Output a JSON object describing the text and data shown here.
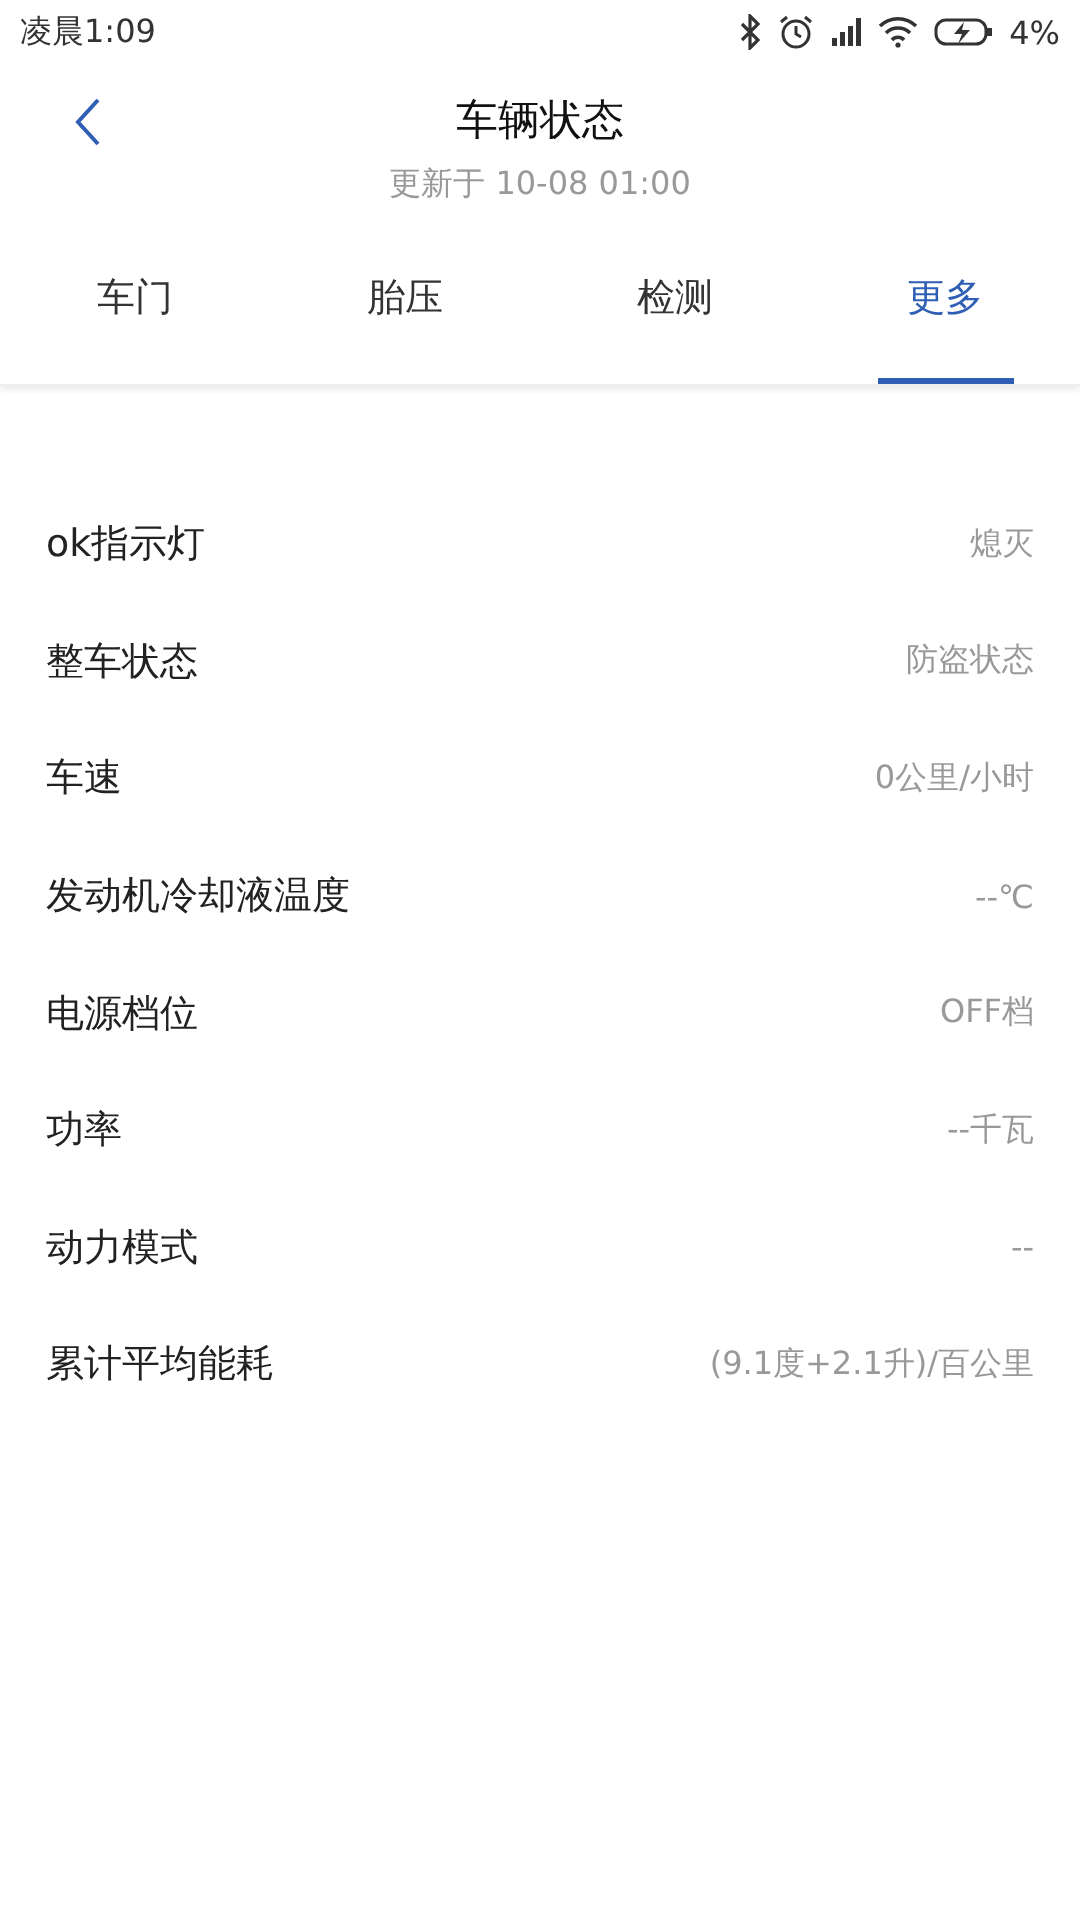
{
  "status_bar": {
    "time": "凌晨1:09",
    "battery": "4%"
  },
  "header": {
    "title": "车辆状态",
    "subtitle": "更新于 10-08 01:00"
  },
  "tabs": [
    {
      "label": "车门",
      "selected": false
    },
    {
      "label": "胎压",
      "selected": false
    },
    {
      "label": "检测",
      "selected": false
    },
    {
      "label": "更多",
      "selected": true
    }
  ],
  "rows": [
    {
      "label": "ok指示灯",
      "value": "熄灭"
    },
    {
      "label": "整车状态",
      "value": "防盗状态"
    },
    {
      "label": "车速",
      "value": "0公里/小时"
    },
    {
      "label": "发动机冷却液温度",
      "value": "--℃"
    },
    {
      "label": "电源档位",
      "value": "OFF档"
    },
    {
      "label": "功率",
      "value": "--千瓦"
    },
    {
      "label": "动力模式",
      "value": "--"
    },
    {
      "label": "累计平均能耗",
      "value": "(9.1度+2.1升)/百公里"
    }
  ]
}
